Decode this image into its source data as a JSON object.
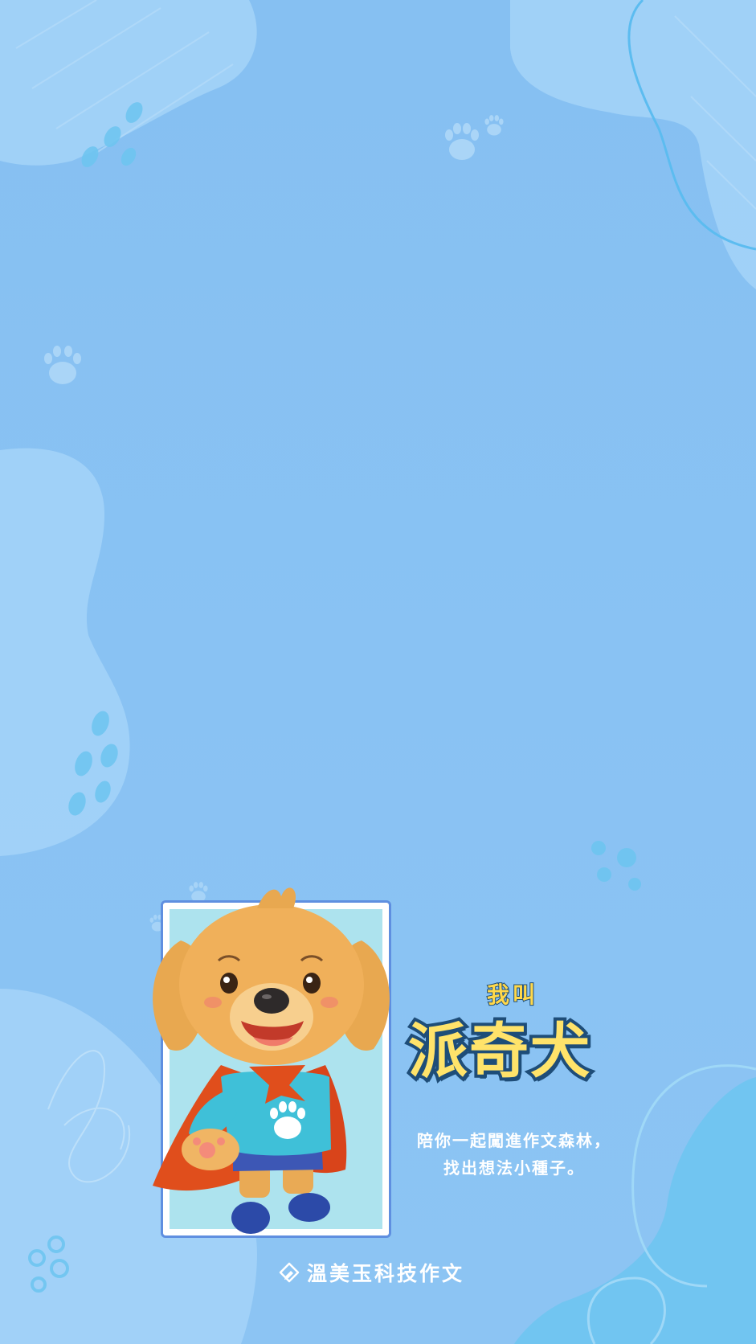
{
  "colors": {
    "background": "#88c1f3",
    "blob_light": "#a7d5f8",
    "accent_cyan": "#6cc5f0",
    "card_border": "#5f8fe0",
    "card_fill": "#ade3ee",
    "title_yellow": "#ffe36a",
    "title_outline": "#1e4d78",
    "text_white": "#ffffff"
  },
  "icons": {
    "decor": [
      "paw-print-icon",
      "paw-print-icon",
      "paw-print-icon",
      "paw-print-icon",
      "paw-print-icon"
    ],
    "brand": "pencil-logo-icon"
  },
  "mascot": {
    "name_prefix": "我叫",
    "name": "派奇犬"
  },
  "tagline": {
    "line1": "陪你一起闖進作文森林，",
    "line2": "找出想法小種子。"
  },
  "brand": {
    "name": "溫美玉科技作文"
  }
}
